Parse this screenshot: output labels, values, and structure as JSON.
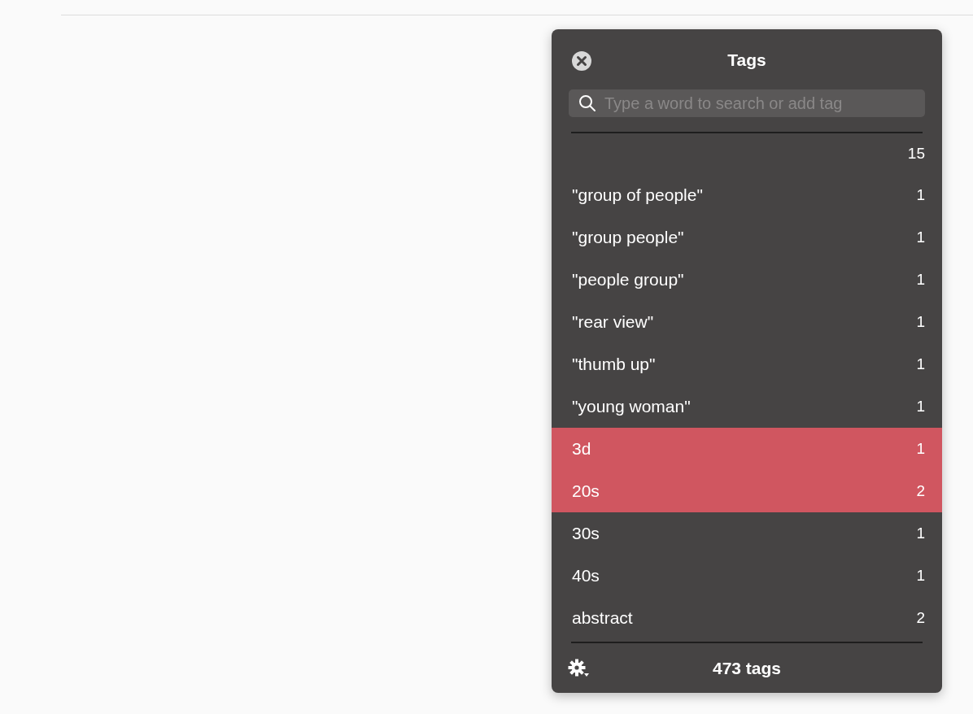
{
  "panel": {
    "title": "Tags",
    "search": {
      "placeholder": "Type a word to search or add tag"
    }
  },
  "tags": [
    {
      "count": "15",
      "selected": false
    },
    {
      "label": "\"group of people\"",
      "count": "1",
      "selected": false
    },
    {
      "label": "\"group people\"",
      "count": "1",
      "selected": false
    },
    {
      "label": "\"people group\"",
      "count": "1",
      "selected": false
    },
    {
      "label": "\"rear view\"",
      "count": "1",
      "selected": false
    },
    {
      "label": "\"thumb up\"",
      "count": "1",
      "selected": false
    },
    {
      "label": "\"young woman\"",
      "count": "1",
      "selected": false
    },
    {
      "label": "3d",
      "count": "1",
      "selected": true
    },
    {
      "label": "20s",
      "count": "2",
      "selected": true
    },
    {
      "label": "30s",
      "count": "1",
      "selected": false
    },
    {
      "label": "40s",
      "count": "1",
      "selected": false
    },
    {
      "label": "abstract",
      "count": "2",
      "selected": false
    }
  ],
  "footer": {
    "summary": "473 tags"
  }
}
